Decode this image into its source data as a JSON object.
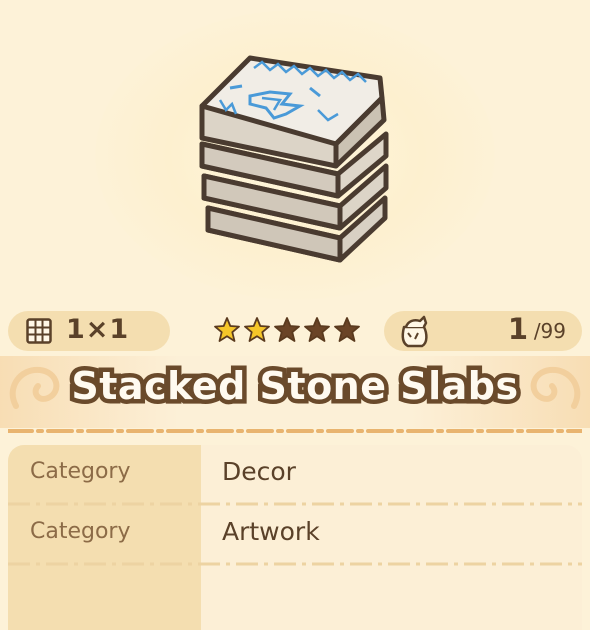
{
  "item": {
    "name": "Stacked Stone Slabs",
    "size": "1×1",
    "rarity_filled": 2,
    "rarity_total": 5,
    "owned": "1",
    "owned_max": "/99"
  },
  "details": [
    {
      "label": "Category",
      "value": "Decor"
    },
    {
      "label": "Category",
      "value": "Artwork"
    }
  ],
  "icons": {
    "size": "grid-icon",
    "rarity": "star-icon",
    "inventory": "bag-icon",
    "item": "stone-slab-stack-icon"
  },
  "colors": {
    "background": "#fdf2d8",
    "pill": "#f4deb0",
    "text_dark": "#5a4129",
    "label_text": "#8c6b47",
    "star_filled": "#f5c629",
    "star_empty": "#6a4426",
    "slab_glyph": "#4a9ad8"
  }
}
